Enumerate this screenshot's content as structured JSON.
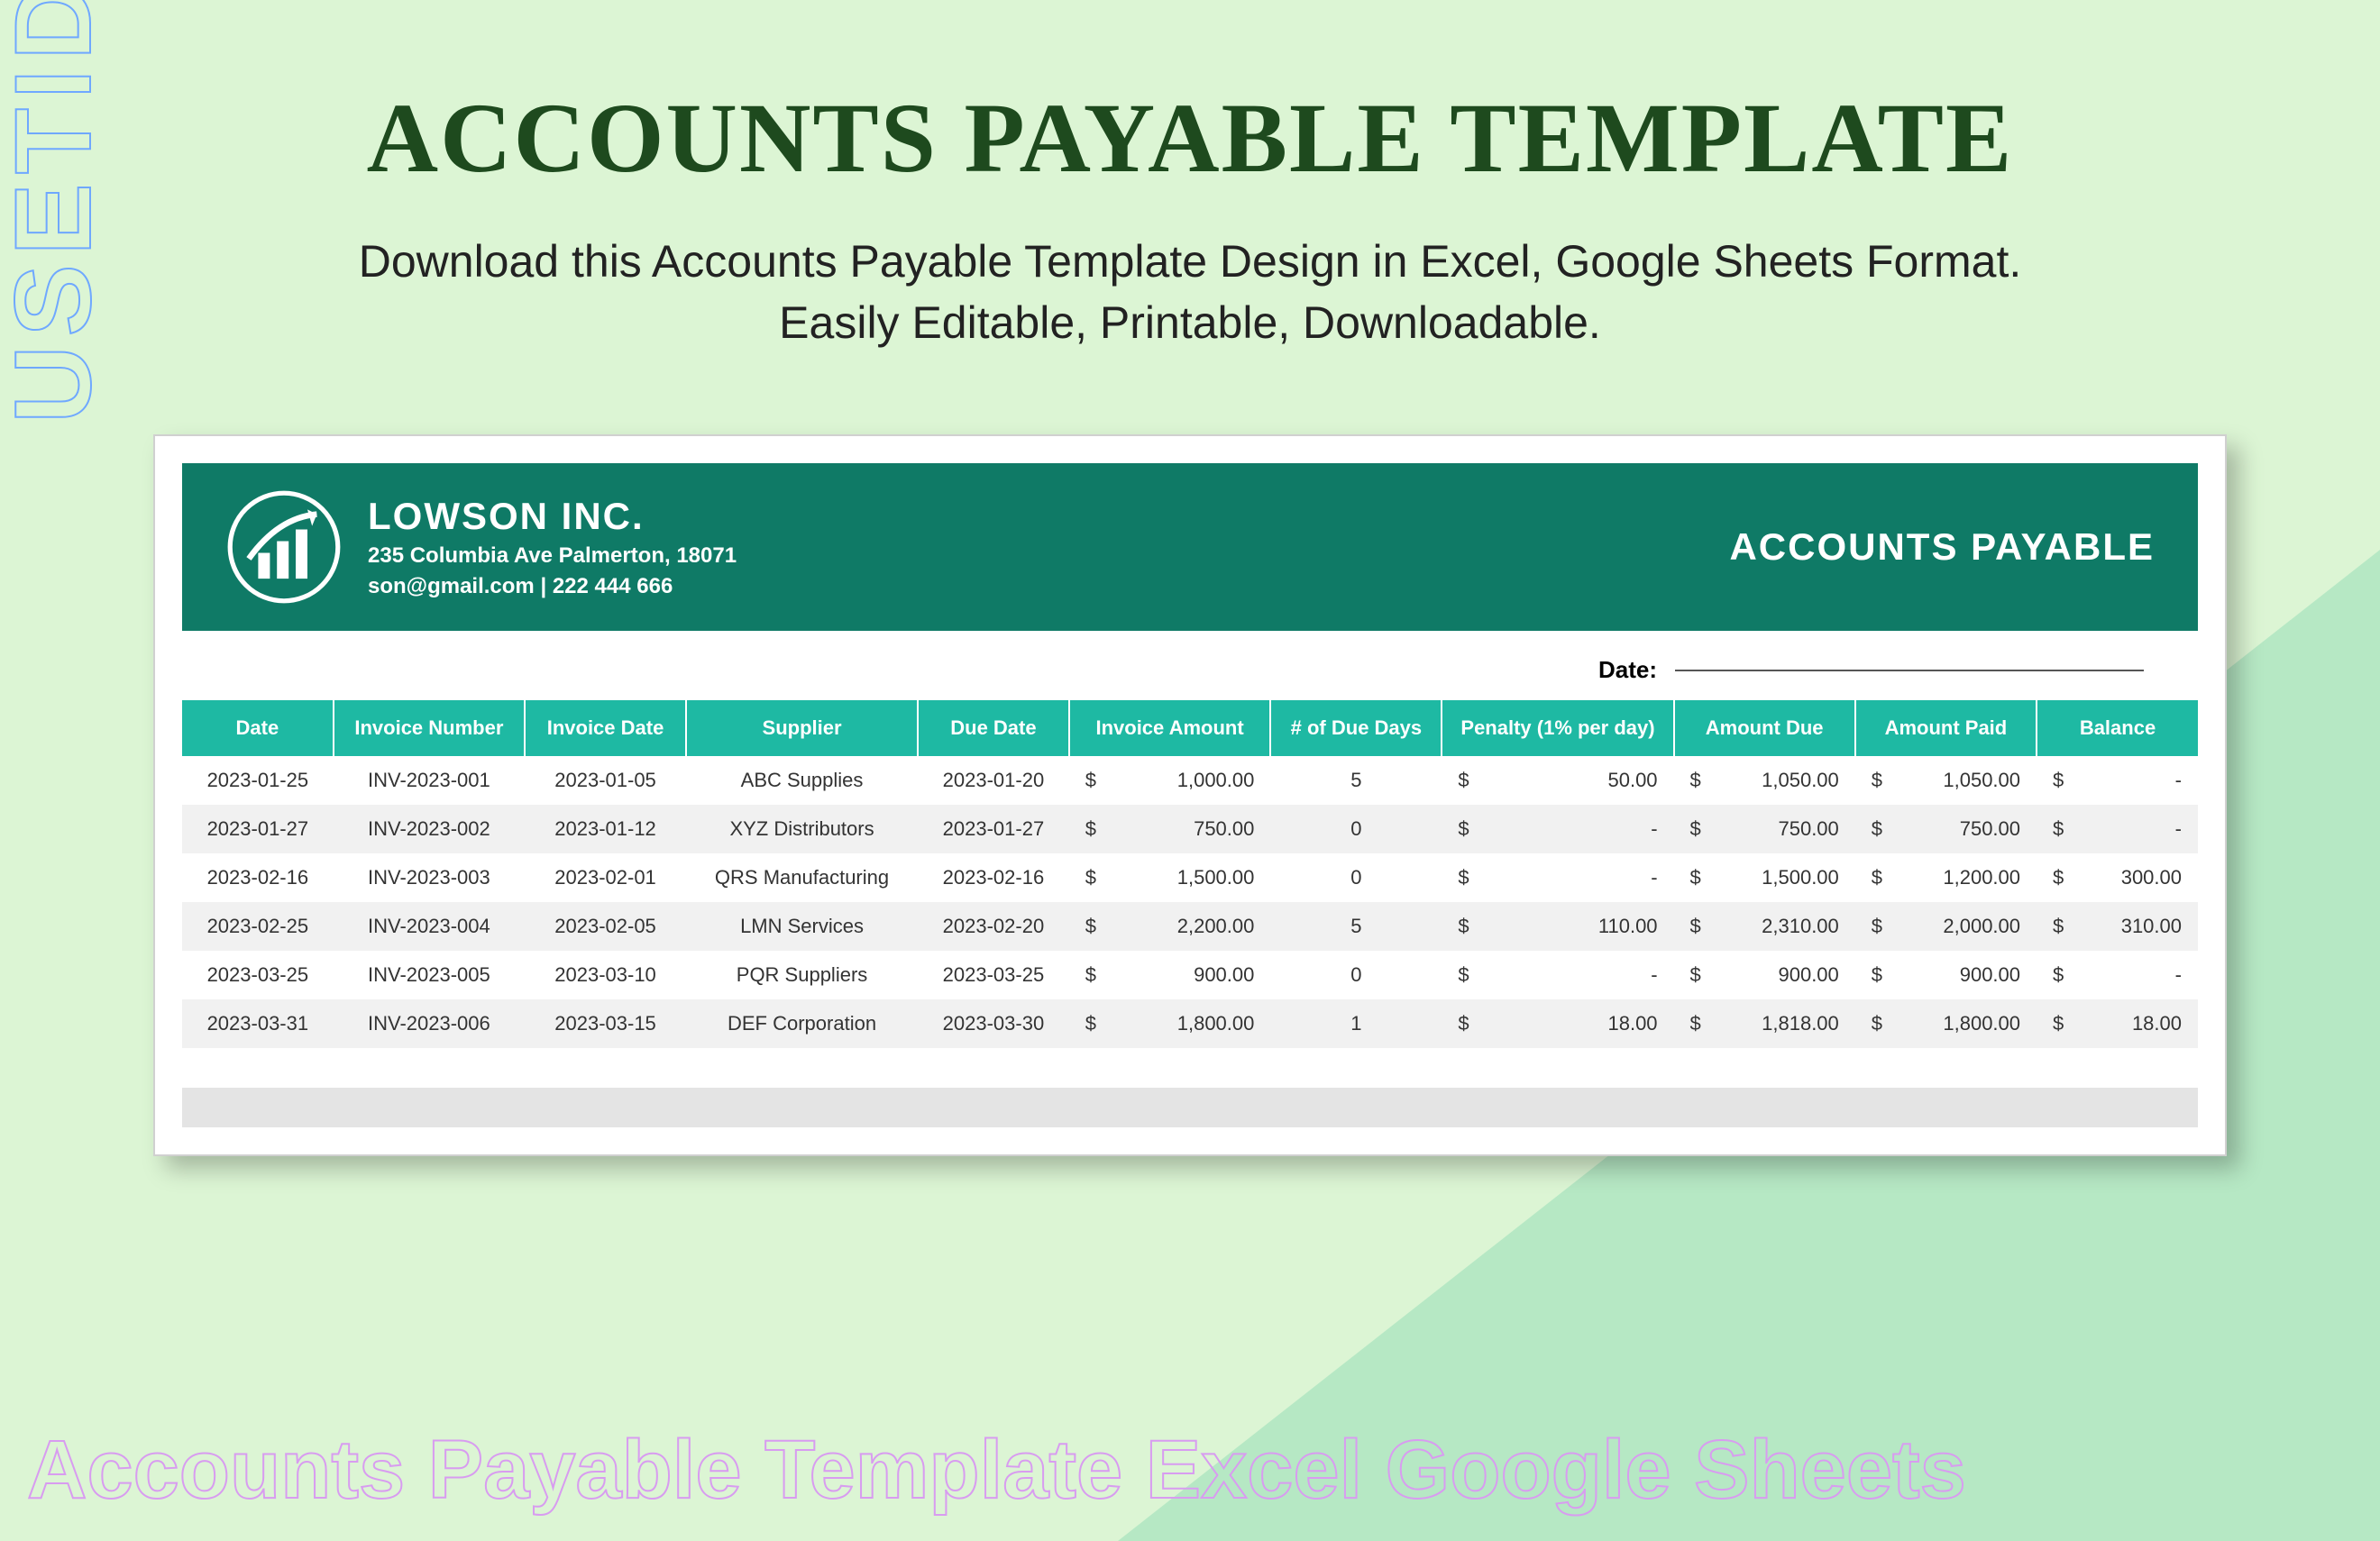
{
  "side_text": "USETID",
  "page": {
    "title": "ACCOUNTS PAYABLE TEMPLATE",
    "subtitle_l1": "Download this Accounts Payable Template Design in Excel, Google Sheets Format.",
    "subtitle_l2": "Easily Editable, Printable, Downloadable."
  },
  "company": {
    "name": "LOWSON INC.",
    "address": "235 Columbia Ave Palmerton, 18071",
    "contact": "son@gmail.com | 222 444 666"
  },
  "doc_title": "ACCOUNTS PAYABLE",
  "date_label": "Date:",
  "columns": [
    "Date",
    "Invoice Number",
    "Invoice Date",
    "Supplier",
    "Due Date",
    "Invoice Amount",
    "# of Due Days",
    "Penalty (1% per day)",
    "Amount Due",
    "Amount Paid",
    "Balance"
  ],
  "chart_data": {
    "type": "table",
    "columns": [
      "Date",
      "Invoice Number",
      "Invoice Date",
      "Supplier",
      "Due Date",
      "Invoice Amount",
      "# of Due Days",
      "Penalty (1% per day)",
      "Amount Due",
      "Amount Paid",
      "Balance"
    ],
    "rows": [
      {
        "date": "2023-01-25",
        "invoice_number": "INV-2023-001",
        "invoice_date": "2023-01-05",
        "supplier": "ABC Supplies",
        "due_date": "2023-01-20",
        "invoice_amount": "1,000.00",
        "due_days": "5",
        "penalty": "50.00",
        "amount_due": "1,050.00",
        "amount_paid": "1,050.00",
        "balance": "-"
      },
      {
        "date": "2023-01-27",
        "invoice_number": "INV-2023-002",
        "invoice_date": "2023-01-12",
        "supplier": "XYZ Distributors",
        "due_date": "2023-01-27",
        "invoice_amount": "750.00",
        "due_days": "0",
        "penalty": "-",
        "amount_due": "750.00",
        "amount_paid": "750.00",
        "balance": "-"
      },
      {
        "date": "2023-02-16",
        "invoice_number": "INV-2023-003",
        "invoice_date": "2023-02-01",
        "supplier": "QRS Manufacturing",
        "due_date": "2023-02-16",
        "invoice_amount": "1,500.00",
        "due_days": "0",
        "penalty": "-",
        "amount_due": "1,500.00",
        "amount_paid": "1,200.00",
        "balance": "300.00"
      },
      {
        "date": "2023-02-25",
        "invoice_number": "INV-2023-004",
        "invoice_date": "2023-02-05",
        "supplier": "LMN Services",
        "due_date": "2023-02-20",
        "invoice_amount": "2,200.00",
        "due_days": "5",
        "penalty": "110.00",
        "amount_due": "2,310.00",
        "amount_paid": "2,000.00",
        "balance": "310.00"
      },
      {
        "date": "2023-03-25",
        "invoice_number": "INV-2023-005",
        "invoice_date": "2023-03-10",
        "supplier": "PQR Suppliers",
        "due_date": "2023-03-25",
        "invoice_amount": "900.00",
        "due_days": "0",
        "penalty": "-",
        "amount_due": "900.00",
        "amount_paid": "900.00",
        "balance": "-"
      },
      {
        "date": "2023-03-31",
        "invoice_number": "INV-2023-006",
        "invoice_date": "2023-03-15",
        "supplier": "DEF Corporation",
        "due_date": "2023-03-30",
        "invoice_amount": "1,800.00",
        "due_days": "1",
        "penalty": "18.00",
        "amount_due": "1,818.00",
        "amount_paid": "1,800.00",
        "balance": "18.00"
      }
    ]
  },
  "footer_caption": "Accounts Payable Template Excel Google Sheets"
}
